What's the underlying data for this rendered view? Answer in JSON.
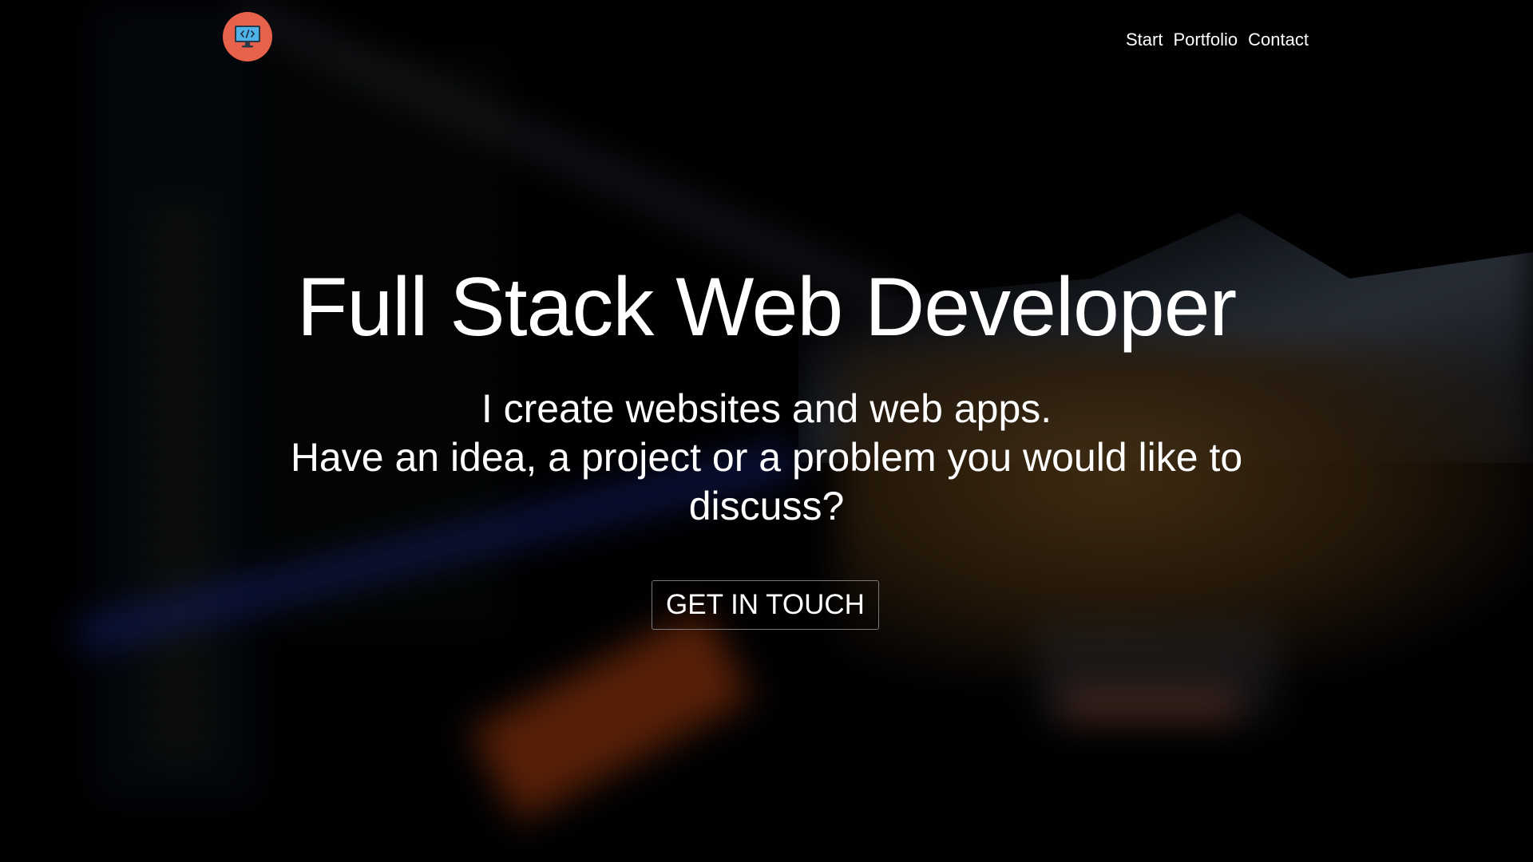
{
  "header": {
    "logo_icon": "monitor-code-icon",
    "logo_color": "#e8614a",
    "nav": [
      {
        "label": "Start"
      },
      {
        "label": "Portfolio"
      },
      {
        "label": "Contact"
      }
    ]
  },
  "hero": {
    "title": "Full Stack Web Developer",
    "subtitle_line1": "I create websites and web apps.",
    "subtitle_line2": "Have an idea, a project or a problem you would like to discuss?",
    "cta_label": "GET IN TOUCH"
  }
}
